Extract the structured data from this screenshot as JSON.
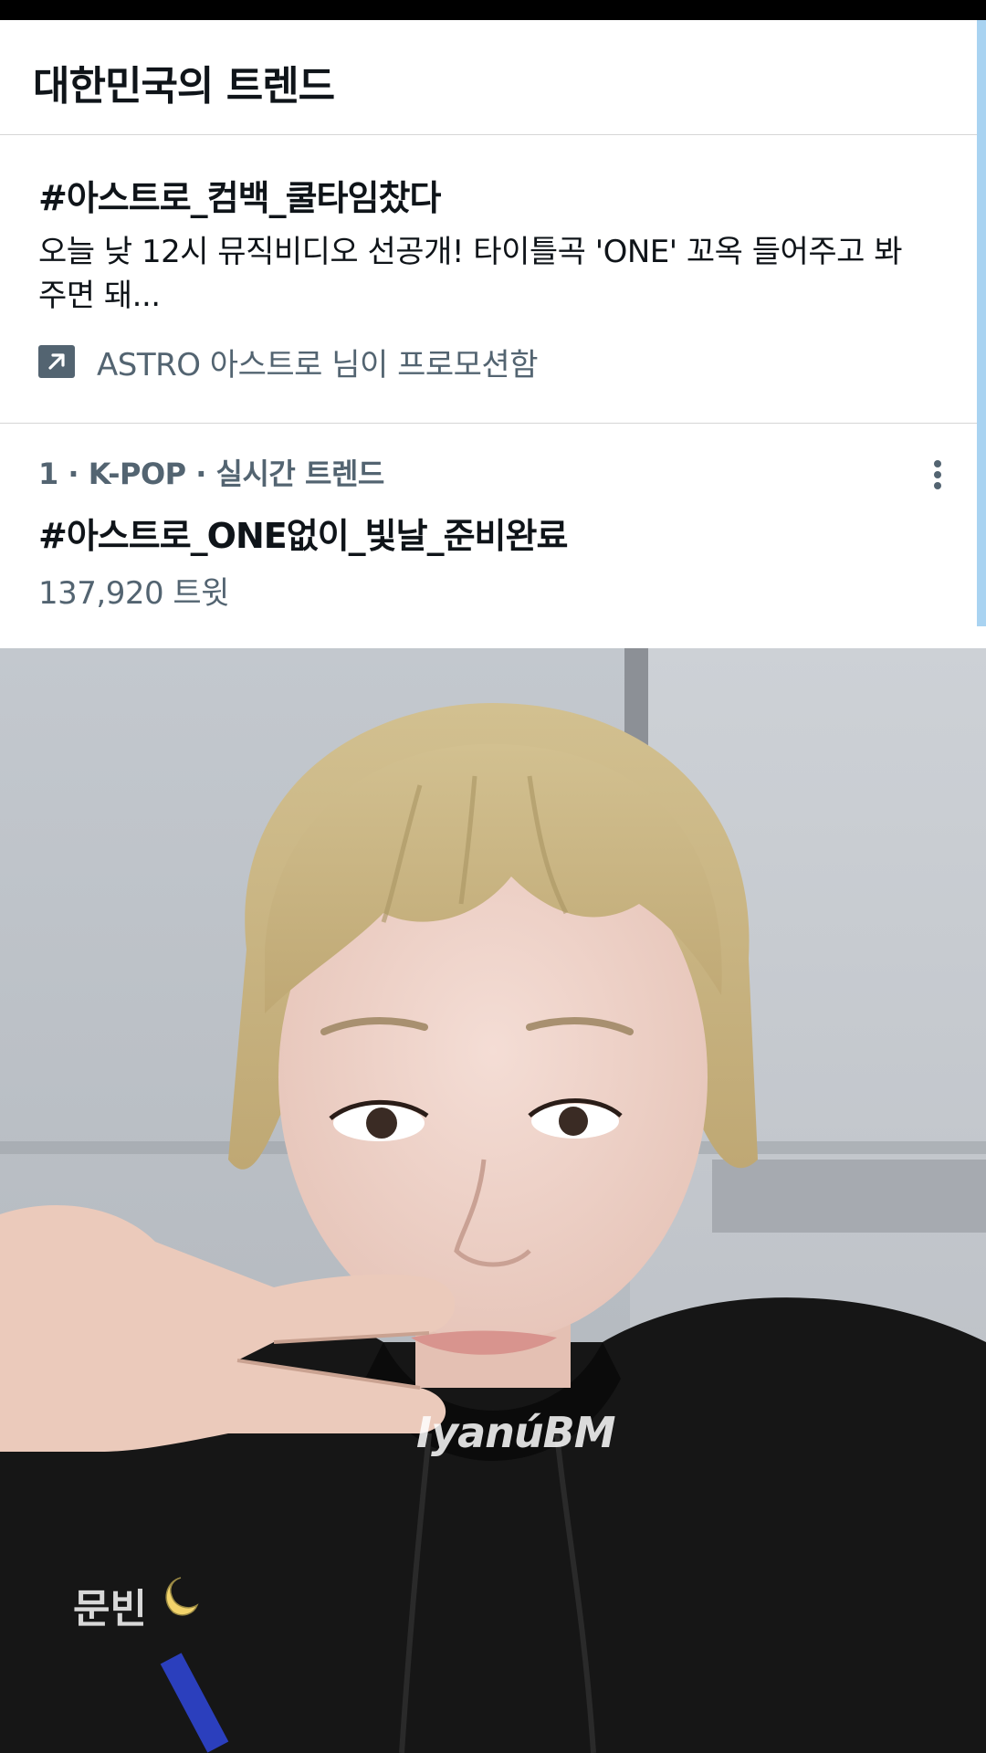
{
  "header": {
    "title": "대한민국의 트렌드"
  },
  "promoted": {
    "hashtag": "#아스트로_컴백_쿨타임찼다",
    "description": "오늘 낮 12시 뮤직비디오 선공개! 타이틀곡 'ONE' 꼬옥 들어주고 봐주면 돼...",
    "promoted_by": "ASTRO 아스트로 님이 프로모션함",
    "icon": "promoted-arrow-icon"
  },
  "trend": {
    "meta": "1 · K-POP · 실시간 트렌드",
    "hashtag": "#아스트로_ONE없이_빛날_준비완료",
    "count": "137,920 트윗",
    "icon": "more-dots-icon"
  },
  "photo": {
    "watermark": "IyanúBM",
    "signature": "문빈",
    "icon": "crescent-moon-icon"
  },
  "colors": {
    "text_primary": "#0f1419",
    "text_secondary": "#536471",
    "divider": "#d6d6d6",
    "scroll_indicator": "#a9d3f1"
  }
}
